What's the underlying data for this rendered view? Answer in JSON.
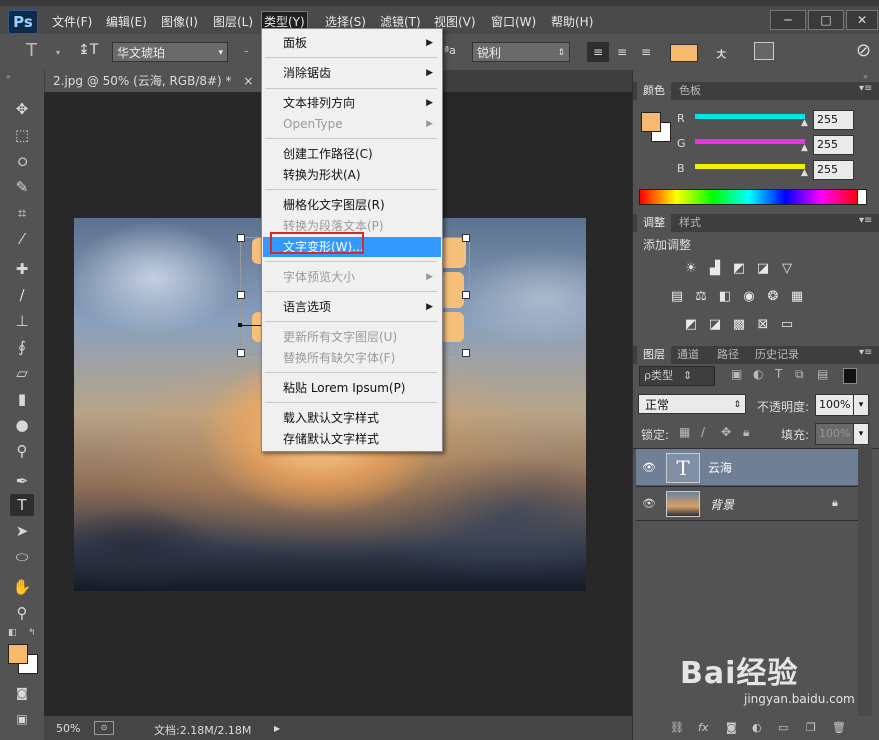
{
  "app": {
    "logo": "Ps"
  },
  "menubar": {
    "items": [
      "文件(F)",
      "编辑(E)",
      "图像(I)",
      "图层(L)",
      "类型(Y)",
      "选择(S)",
      "滤镜(T)",
      "视图(V)",
      "窗口(W)",
      "帮助(H)"
    ],
    "active": "类型(Y)",
    "window_buttons": [
      "─",
      "□",
      "✕"
    ]
  },
  "options_bar": {
    "tool_icon": "T",
    "orient_icon": "↨T",
    "font_family": "华文琥珀",
    "font_style": "-",
    "aa_icon": "ªa",
    "antialias": "锐利",
    "text_color": "#f7b96e"
  },
  "document": {
    "tab_title": "2.jpg @ 50% (云海, RGB/8#) *",
    "close": "×"
  },
  "type_menu": {
    "items": [
      {
        "label": "面板",
        "submenu": true,
        "disabled": false
      },
      {
        "label": "消除锯齿",
        "submenu": true,
        "disabled": false
      },
      {
        "label": "文本排列方向",
        "submenu": true,
        "disabled": false
      },
      {
        "label": "OpenType",
        "submenu": true,
        "disabled": true
      },
      {
        "label": "创建工作路径(C)",
        "submenu": false,
        "disabled": false
      },
      {
        "label": "转换为形状(A)",
        "submenu": false,
        "disabled": false
      },
      {
        "label": "栅格化文字图层(R)",
        "submenu": false,
        "disabled": false
      },
      {
        "label": "转换为段落文本(P)",
        "submenu": false,
        "disabled": true
      },
      {
        "label": "文字变形(W)...",
        "submenu": false,
        "disabled": false,
        "highlighted": true
      },
      {
        "label": "字体预览大小",
        "submenu": true,
        "disabled": true
      },
      {
        "label": "语言选项",
        "submenu": true,
        "disabled": false
      },
      {
        "label": "更新所有文字图层(U)",
        "submenu": false,
        "disabled": true
      },
      {
        "label": "替换所有缺欠字体(F)",
        "submenu": false,
        "disabled": true
      },
      {
        "label": "粘贴 Lorem Ipsum(P)",
        "submenu": false,
        "disabled": false
      },
      {
        "label": "载入默认文字样式",
        "submenu": false,
        "disabled": false
      },
      {
        "label": "存储默认文字样式",
        "submenu": false,
        "disabled": false
      }
    ]
  },
  "color_panel": {
    "tabs": [
      "颜色",
      "色板"
    ],
    "channels": [
      {
        "label": "R",
        "value": "255",
        "color": "#00e5e5"
      },
      {
        "label": "G",
        "value": "255",
        "color": "#e533e5"
      },
      {
        "label": "B",
        "value": "255",
        "color": "#f2f200"
      }
    ],
    "foreground": "#f7b96e",
    "background": "#ffffff"
  },
  "adjust_panel": {
    "tabs": [
      "调整",
      "样式"
    ],
    "title": "添加调整"
  },
  "layers_panel": {
    "tabs": [
      "图层",
      "通道",
      "路径",
      "历史记录"
    ],
    "filter_label": "ρ类型",
    "blend_mode": "正常",
    "opacity_label": "不透明度:",
    "opacity_value": "100%",
    "lock_label": "锁定:",
    "fill_label": "填充:",
    "fill_value": "100%",
    "layers": [
      {
        "name": "云海",
        "thumb": "T",
        "selected": true
      },
      {
        "name": "背景",
        "thumb": "photo",
        "selected": false,
        "locked": true
      }
    ],
    "footer_icons": [
      "link-icon",
      "fx",
      "mask-icon",
      "adjust-icon",
      "folder-icon",
      "new-layer-icon",
      "trash-icon"
    ]
  },
  "status_bar": {
    "zoom": "50%",
    "doc_info": "文档:2.18M/2.18M"
  },
  "watermark": {
    "brand": "Bai经验",
    "url": "jingyan.baidu.com"
  }
}
